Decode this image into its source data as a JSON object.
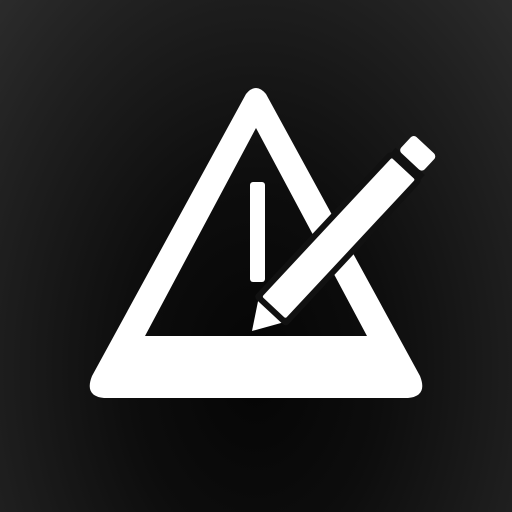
{
  "icon": {
    "name": "metronome-with-pencil-icon",
    "background_color": "#1a1a1a",
    "glyph_color": "#ffffff"
  }
}
